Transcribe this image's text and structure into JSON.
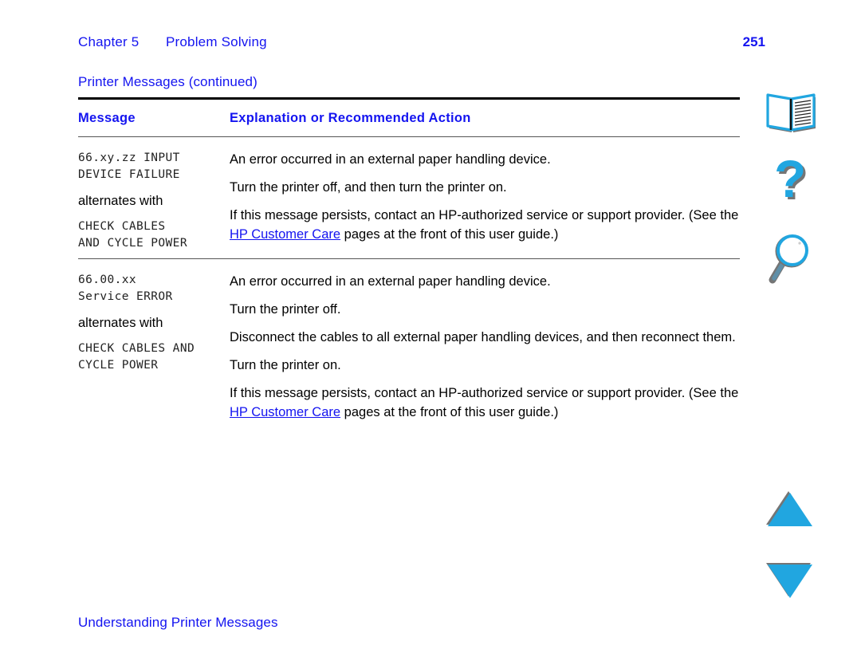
{
  "header": {
    "chapter": "Chapter 5",
    "title": "Problem Solving",
    "page_number": "251"
  },
  "section": {
    "title": "Printer Messages (continued)"
  },
  "table": {
    "columns": {
      "message": "Message",
      "explanation": "Explanation or Recommended Action"
    },
    "rows": [
      {
        "message_lines_top": [
          "66.xy.zz INPUT",
          "DEVICE FAILURE"
        ],
        "alternates_label": "alternates with",
        "message_lines_bottom": [
          "CHECK CABLES",
          "AND CYCLE POWER"
        ],
        "paragraphs": [
          "An error occurred in an external paper handling device.",
          "Turn the printer off, and then turn the printer on."
        ],
        "final_paragraph": {
          "before_link": "If this message persists, contact an HP-authorized service or support provider. (See the ",
          "link_text": "HP Customer Care",
          "after_link": " pages at the front of this user guide.)"
        }
      },
      {
        "message_lines_top": [
          "66.00.xx",
          "Service ERROR"
        ],
        "alternates_label": "alternates with",
        "message_lines_bottom": [
          "CHECK CABLES AND",
          "CYCLE POWER"
        ],
        "paragraphs": [
          "An error occurred in an external paper handling device.",
          "Turn the printer off.",
          "Disconnect the cables to all external paper handling devices, and then reconnect them.",
          "Turn the printer on."
        ],
        "final_paragraph": {
          "before_link": "If this message persists, contact an HP-authorized service or support provider. (See the ",
          "link_text": "HP Customer Care",
          "after_link": " pages at the front of this user guide.)"
        }
      }
    ]
  },
  "footer": {
    "text": "Understanding Printer Messages"
  },
  "nav": {
    "book_icon": "book-icon",
    "help_icon": "question-mark-icon",
    "search_icon": "magnifier-icon",
    "up_icon": "triangle-up-icon",
    "down_icon": "triangle-down-icon"
  },
  "colors": {
    "blue_text": "#1414f0",
    "link": "#1414f0",
    "icon_cyan": "#21a6e0",
    "icon_shadow": "#757575",
    "rule_dark": "#000000",
    "rule_light": "#555555"
  }
}
